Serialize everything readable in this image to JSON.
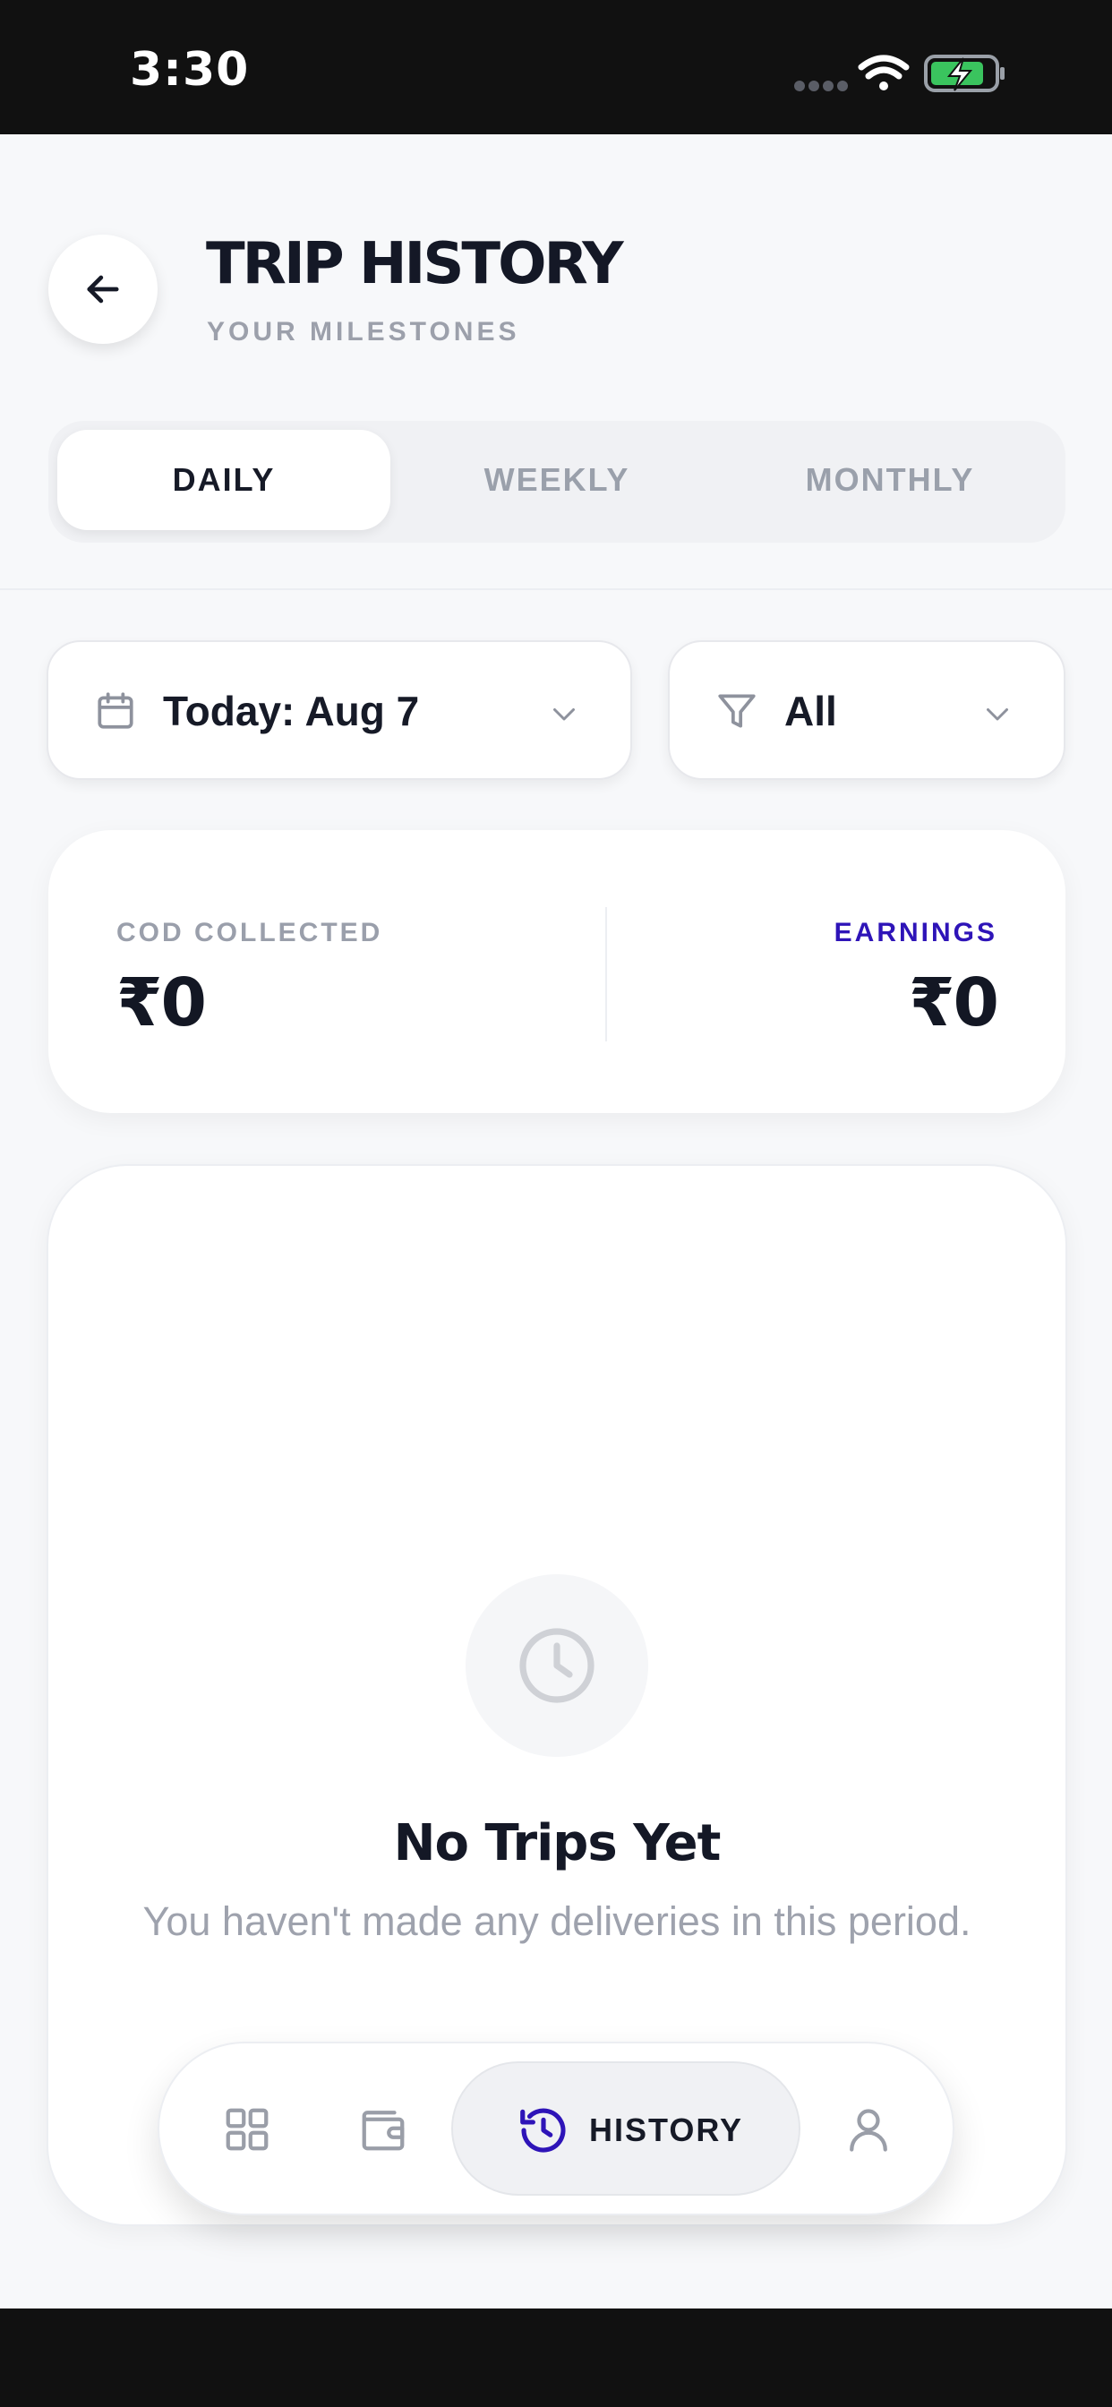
{
  "status_bar": {
    "time": "3:30"
  },
  "header": {
    "title": "TRIP HISTORY",
    "subtitle": "YOUR MILESTONES"
  },
  "tabs": [
    {
      "label": "DAILY",
      "active": true
    },
    {
      "label": "WEEKLY",
      "active": false
    },
    {
      "label": "MONTHLY",
      "active": false
    }
  ],
  "filters": {
    "date_value": "Today: Aug 7",
    "type_value": "All"
  },
  "summary": {
    "cod_label": "COD COLLECTED",
    "cod_value": "₹0",
    "earnings_label": "EARNINGS",
    "earnings_value": "₹0"
  },
  "empty_state": {
    "title": "No Trips Yet",
    "description": "You haven't made any deliveries in this period."
  },
  "bottom_nav": {
    "items": [
      {
        "icon": "grid-icon",
        "active": false
      },
      {
        "icon": "wallet-icon",
        "active": false
      },
      {
        "icon": "history-icon",
        "label": "HISTORY",
        "active": true
      },
      {
        "icon": "user-icon",
        "active": false
      }
    ]
  },
  "colors": {
    "accent": "#2e14b8",
    "text_dark": "#141826",
    "text_muted": "#9ca0ab",
    "background": "#f7f8fa",
    "battery_green": "#3ac45e"
  }
}
